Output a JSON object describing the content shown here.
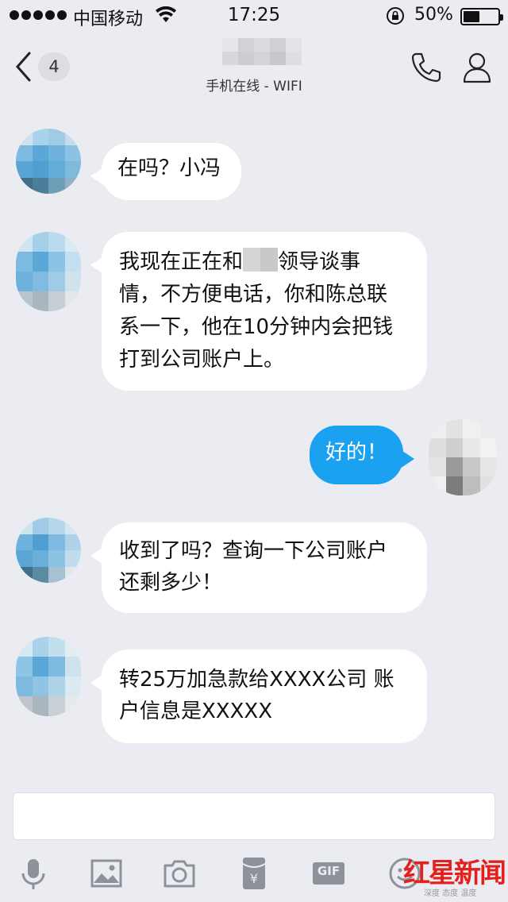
{
  "status_bar": {
    "carrier": "中国移动",
    "time": "17:25",
    "battery": "50%"
  },
  "header": {
    "unread_count": "4",
    "status": "手机在线 - WIFI",
    "back_icon": "chevron-left-icon",
    "call_icon": "phone-icon",
    "profile_icon": "person-icon"
  },
  "messages": [
    {
      "sender": "contact",
      "text": "在吗？小冯"
    },
    {
      "sender": "contact",
      "lines": [
        "我现在正在和",
        "领导谈事",
        "情，不方便电话，你和陈总联",
        "系一下，他在10分钟内会把钱",
        "打到公司账户上。"
      ]
    },
    {
      "sender": "me",
      "text": "好的！"
    },
    {
      "sender": "contact",
      "lines": [
        "收到了吗？查询一下公司账户",
        "还剩多少！"
      ]
    },
    {
      "sender": "contact",
      "lines": [
        "转25万加急款给XXXX公司 账",
        "户信息是XXXXX"
      ]
    }
  ],
  "toolbar": {
    "gif_label": "GIF",
    "items": [
      "microphone-icon",
      "image-icon",
      "camera-icon",
      "red-packet-icon",
      "gif-icon",
      "emoji-icon"
    ]
  },
  "watermark": {
    "logo": "红星新闻",
    "tagline": "深度 态度 温度"
  },
  "colors": {
    "background": "#ebecf2",
    "my_bubble": "#1aa1ef",
    "contact_bubble": "#ffffff"
  }
}
